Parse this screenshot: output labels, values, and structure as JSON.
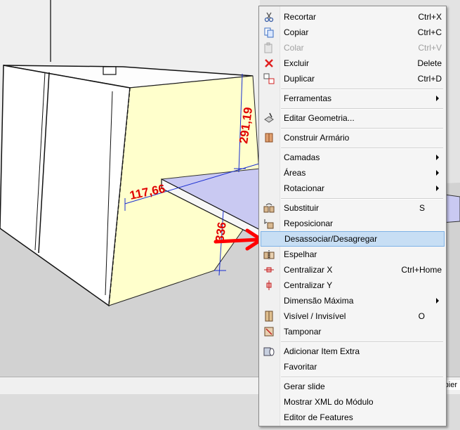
{
  "canvas": {
    "dimensions": {
      "width": "117,66",
      "depth": "291,19",
      "height": "336"
    },
    "bottom_tab_text": "pier"
  },
  "context_menu": {
    "items": [
      {
        "id": "recortar",
        "label": "Recortar",
        "shortcut": "Ctrl+X",
        "icon": "scissors-icon"
      },
      {
        "id": "copiar",
        "label": "Copiar",
        "shortcut": "Ctrl+C",
        "icon": "copy-icon"
      },
      {
        "id": "colar",
        "label": "Colar",
        "shortcut": "Ctrl+V",
        "icon": "paste-icon",
        "disabled": true
      },
      {
        "id": "excluir",
        "label": "Excluir",
        "shortcut": "Delete",
        "icon": "delete-x-icon"
      },
      {
        "id": "duplicar",
        "label": "Duplicar",
        "shortcut": "Ctrl+D",
        "icon": "duplicate-icon"
      },
      {
        "id": "ferramentas",
        "label": "Ferramentas",
        "submenu": true
      },
      {
        "id": "editar-geometria",
        "label": "Editar Geometria...",
        "icon": "edit-geometry-icon"
      },
      {
        "id": "construir-armario",
        "label": "Construir Armário",
        "icon": "cabinet-icon"
      },
      {
        "id": "camadas",
        "label": "Camadas",
        "submenu": true
      },
      {
        "id": "areas",
        "label": "Áreas",
        "submenu": true
      },
      {
        "id": "rotacionar",
        "label": "Rotacionar",
        "submenu": true
      },
      {
        "id": "substituir",
        "label": "Substituir",
        "shortcut": "S",
        "icon": "replace-icon"
      },
      {
        "id": "reposicionar",
        "label": "Reposicionar",
        "icon": "reposition-icon"
      },
      {
        "id": "desassociar",
        "label": "Desassociar/Desagregar",
        "icon": "ungroup-icon",
        "highlighted": true
      },
      {
        "id": "espelhar",
        "label": "Espelhar",
        "icon": "mirror-icon"
      },
      {
        "id": "centralizar-x",
        "label": "Centralizar X",
        "shortcut": "Ctrl+Home",
        "icon": "center-x-icon"
      },
      {
        "id": "centralizar-y",
        "label": "Centralizar Y",
        "icon": "center-y-icon"
      },
      {
        "id": "dimensao-maxima",
        "label": "Dimensão Máxima",
        "submenu": true
      },
      {
        "id": "visivel",
        "label": "Visível / Invisível",
        "shortcut": "O",
        "icon": "visibility-icon"
      },
      {
        "id": "tamponar",
        "label": "Tamponar",
        "icon": "cover-icon"
      },
      {
        "id": "adicionar-item",
        "label": "Adicionar Item Extra",
        "icon": "add-extra-item-icon"
      },
      {
        "id": "favoritar",
        "label": "Favoritar"
      },
      {
        "id": "gerar-slide",
        "label": "Gerar slide"
      },
      {
        "id": "mostrar-xml",
        "label": "Mostrar XML do Módulo"
      },
      {
        "id": "editor-features",
        "label": "Editor de Features"
      }
    ]
  },
  "colors": {
    "highlight_bg": "#c7def4",
    "highlight_border": "#7eb2e6",
    "annotation_arrow": "#ff0000",
    "dimension_text": "#e00000",
    "dimension_line": "#1b2fd1",
    "panel_yellow": "#ffffcc",
    "shelf_lilac": "#c9c9f2"
  }
}
